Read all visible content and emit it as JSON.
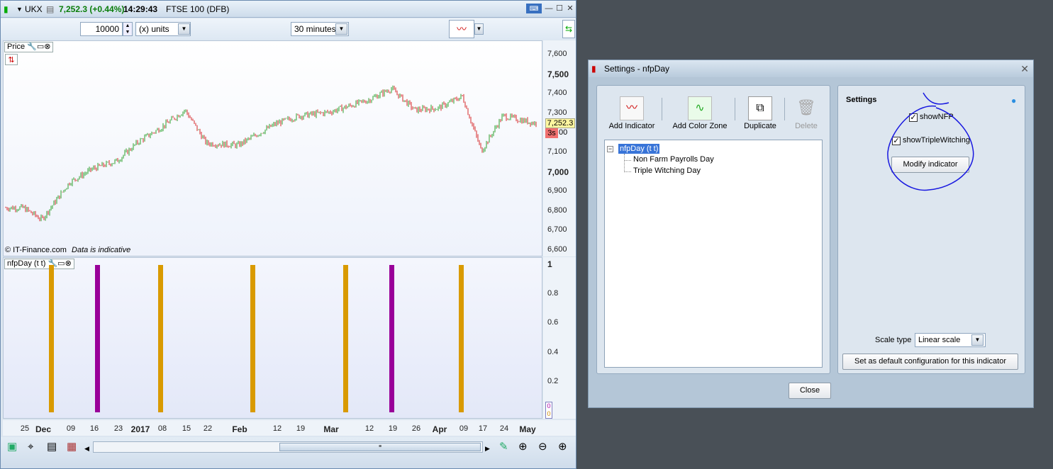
{
  "header": {
    "symbol": "UKX",
    "price_change": "7,252.3 (+0.44%)",
    "time": "14:29:43",
    "instrument": "FTSE 100 (DFB)"
  },
  "toolbar": {
    "quantity": "10000",
    "units": "(x) units",
    "timeframe": "30 minutes"
  },
  "price_pane": {
    "label": "Price",
    "yticks": [
      {
        "v": "7,600",
        "b": false
      },
      {
        "v": "7,500",
        "b": true
      },
      {
        "v": "7,400",
        "b": false
      },
      {
        "v": "7,300",
        "b": false
      },
      {
        "v": "7,100",
        "b": false
      },
      {
        "v": "7,000",
        "b": true
      },
      {
        "v": "6,900",
        "b": false
      },
      {
        "v": "6,800",
        "b": false
      },
      {
        "v": "6,700",
        "b": false
      },
      {
        "v": "6,600",
        "b": false
      }
    ],
    "current_price": "7,252.3",
    "countdown": "3s",
    "partial_tick": "00",
    "watermark": "© IT-Finance.com",
    "disclaimer": "Data is indicative"
  },
  "indicator_pane": {
    "label": "nfpDay (t t)",
    "yticks": [
      "1",
      "0.8",
      "0.6",
      "0.4",
      "0.2"
    ],
    "bottom_values": [
      "0",
      "0"
    ]
  },
  "x_axis": [
    {
      "t": "25",
      "b": false
    },
    {
      "t": "Dec",
      "b": true
    },
    {
      "t": "09",
      "b": false
    },
    {
      "t": "16",
      "b": false
    },
    {
      "t": "23",
      "b": false
    },
    {
      "t": "2017",
      "b": true
    },
    {
      "t": "08",
      "b": false
    },
    {
      "t": "15",
      "b": false
    },
    {
      "t": "22",
      "b": false
    },
    {
      "t": "Feb",
      "b": true
    },
    {
      "t": "12",
      "b": false
    },
    {
      "t": "19",
      "b": false
    },
    {
      "t": "Mar",
      "b": true
    },
    {
      "t": "12",
      "b": false
    },
    {
      "t": "19",
      "b": false
    },
    {
      "t": "26",
      "b": false
    },
    {
      "t": "Apr",
      "b": true
    },
    {
      "t": "09",
      "b": false
    },
    {
      "t": "17",
      "b": false
    },
    {
      "t": "24",
      "b": false
    },
    {
      "t": "May",
      "b": true
    }
  ],
  "chart_data": [
    {
      "type": "bar",
      "title": "nfpDay (t t)",
      "ylim": [
        0,
        1
      ],
      "series": [
        {
          "name": "Non Farm Payrolls Day",
          "color": "#d99a00",
          "x": [
            "Dec 02",
            "Jan 06",
            "Feb 03",
            "Mar 10",
            "Apr 07"
          ],
          "values": [
            1,
            1,
            1,
            1,
            1
          ]
        },
        {
          "name": "Triple Witching Day",
          "color": "#990099",
          "x": [
            "Dec 16",
            "Mar 17"
          ],
          "values": [
            1,
            1
          ]
        }
      ]
    },
    {
      "type": "line",
      "title": "Price",
      "ylim": [
        6600,
        7600
      ],
      "x": [
        "Nov 25",
        "Dec 02",
        "Dec 09",
        "Dec 16",
        "Dec 23",
        "Jan 02",
        "Jan 08",
        "Jan 15",
        "Jan 22",
        "Feb 01",
        "Feb 12",
        "Feb 19",
        "Mar 01",
        "Mar 12",
        "Mar 19",
        "Mar 26",
        "Apr 01",
        "Apr 09",
        "Apr 17",
        "Apr 24",
        "May 01"
      ],
      "values": [
        6820,
        6760,
        6950,
        7020,
        7060,
        7160,
        7230,
        7320,
        7150,
        7140,
        7250,
        7290,
        7310,
        7370,
        7430,
        7320,
        7330,
        7390,
        7110,
        7290,
        7252
      ]
    }
  ],
  "settings": {
    "title": "Settings - nfpDay",
    "toolbar": [
      "Add Indicator",
      "Add Color Zone",
      "Duplicate",
      "Delete"
    ],
    "tree_root": "nfpDay (t t)",
    "tree_children": [
      "Non Farm Payrolls Day",
      "Triple Witching Day"
    ],
    "panel_title": "Settings",
    "opt1": "showNFP",
    "opt2": "showTripleWitching",
    "modify": "Modify indicator",
    "scale_label": "Scale type",
    "scale_value": "Linear scale",
    "default_btn": "Set as default configuration for this indicator",
    "close": "Close"
  },
  "colors": {
    "nfp": "#d99a00",
    "triple": "#990099",
    "up": "#2ca02c",
    "down": "#d62728",
    "annotation": "#1818e0"
  }
}
